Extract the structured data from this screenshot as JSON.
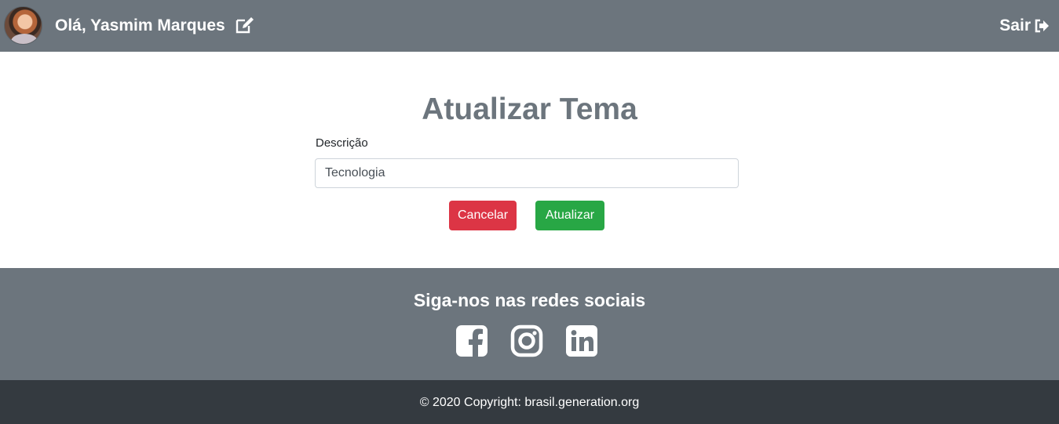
{
  "header": {
    "greeting": "Olá, Yasmim Marques",
    "logout_label": "Sair",
    "avatar_icon": "user-avatar",
    "edit_icon": "edit-icon",
    "logout_icon": "sign-out-icon"
  },
  "form": {
    "title": "Atualizar Tema",
    "description_label": "Descrição",
    "description_value": "Tecnologia",
    "cancel_label": "Cancelar",
    "update_label": "Atualizar"
  },
  "footer": {
    "social_title": "Siga-nos nas redes sociais",
    "social_icons": [
      "facebook-icon",
      "instagram-icon",
      "linkedin-icon"
    ],
    "copyright": "© 2020 Copyright: brasil.generation.org"
  },
  "colors": {
    "header_bg": "#6c757d",
    "title": "#6c757d",
    "cancel": "#dc3545",
    "update": "#28a745",
    "copyright_bg": "#343a40"
  }
}
